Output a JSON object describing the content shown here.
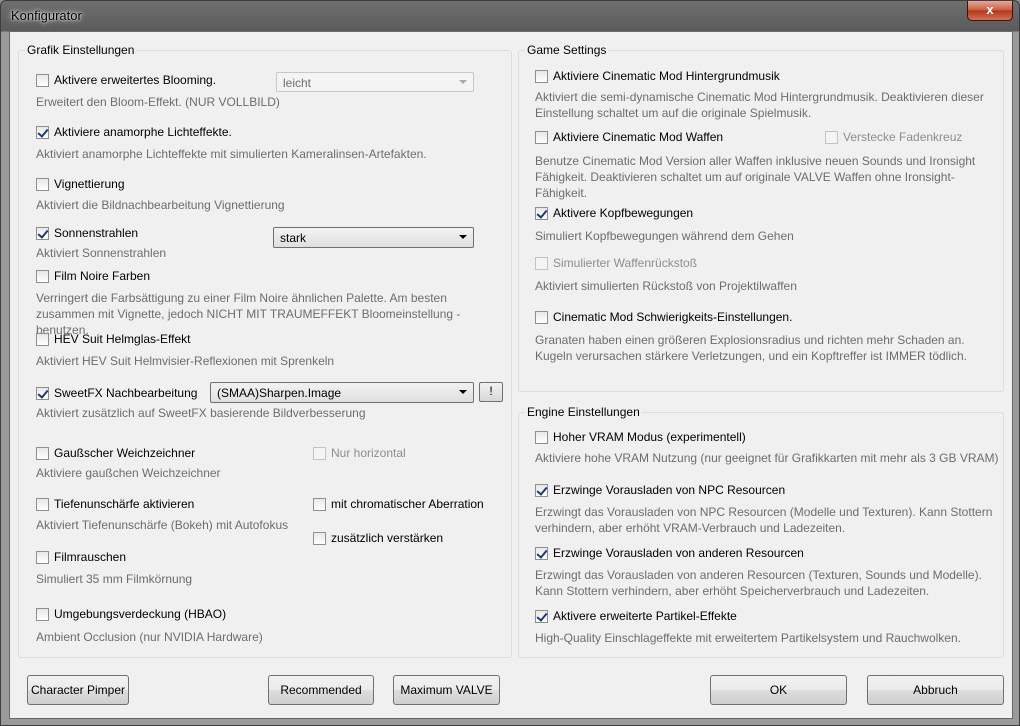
{
  "window": {
    "title": "Konfigurator",
    "close_glyph": "x"
  },
  "grafik": {
    "title": "Grafik Einstellungen",
    "blooming": {
      "label": "Aktivere erweitertes Blooming.",
      "checked": false,
      "desc": "Erweitert den Bloom-Effekt. (NUR VOLLBILD)",
      "select_value": "leicht"
    },
    "anamorph": {
      "label": "Aktiviere anamorphe Lichteffekte.",
      "checked": true,
      "desc": "Aktiviert anamorphe Lichteffekte mit simulierten Kameralinsen-Artefakten."
    },
    "vignette": {
      "label": "Vignettierung",
      "checked": false,
      "desc": "Aktiviert die Bildnachbearbeitung Vignettierung"
    },
    "sonnen": {
      "label": "Sonnenstrahlen",
      "checked": true,
      "desc": "Aktiviert Sonnenstrahlen",
      "select_value": "stark"
    },
    "filmnoire": {
      "label": "Film Noire Farben",
      "checked": false,
      "desc": "Verringert die Farbsättigung zu einer Film Noire ähnlichen Palette. Am besten zusammen mit Vignette, jedoch NICHT MIT TRAUMEFFEKT Bloomeinstellung - benutzen."
    },
    "hev": {
      "label": "HEV Suit Helmglas-Effekt",
      "checked": false,
      "desc": "Aktiviert HEV Suit Helmvisier-Reflexionen mit Sprenkeln"
    },
    "sweetfx": {
      "label": "SweetFX Nachbearbeitung",
      "checked": true,
      "desc": "Aktiviert zusätzlich auf SweetFX basierende Bildverbesserung",
      "select_value": "(SMAA)Sharpen.Image",
      "info_button": "!"
    },
    "gauss": {
      "label": "Gaußscher Weichzeichner",
      "checked": false,
      "desc": "Aktiviere gaußchen Weichzeichner",
      "extra_label": "Nur horizontal"
    },
    "tiefen": {
      "label": "Tiefenunschärfe aktivieren",
      "checked": false,
      "desc": "Aktiviert Tiefenunschärfe (Bokeh) mit Autofokus",
      "extra1_label": "mit chromatischer Aberration",
      "extra2_label": "zusätzlich verstärken"
    },
    "film": {
      "label": "Filmrauschen",
      "checked": false,
      "desc": "Simuliert 35 mm Filmkörnung"
    },
    "hbao": {
      "label": "Umgebungsverdeckung (HBAO)",
      "checked": false,
      "desc": "Ambient Occlusion (nur NVIDIA Hardware)"
    }
  },
  "game": {
    "title": "Game Settings",
    "musik": {
      "label": "Aktiviere Cinematic Mod Hintergrundmusik",
      "checked": false,
      "desc": "Aktiviert die semi-dynamische Cinematic Mod Hintergrundmusik. Deaktivieren dieser Einstellung schaltet um auf die originale Spielmusik."
    },
    "waffen": {
      "label": "Aktiviere Cinematic Mod Waffen",
      "checked": false,
      "desc": "Benutze Cinematic Mod Version aller Waffen inklusive neuen Sounds und Ironsight Fähigkeit. Deaktivieren schaltet um auf originale VALVE Waffen ohne Ironsight-Fähigkeit.",
      "extra_label": "Verstecke Fadenkreuz"
    },
    "kopf": {
      "label": "Aktivere Kopfbewegungen",
      "checked": true,
      "desc": "Simuliert Kopfbewegungen während dem Gehen"
    },
    "rueck": {
      "label": "Simulierter Waffenrückstoß",
      "checked": false,
      "desc": "Aktiviert simulierten Rückstoß von Projektilwaffen"
    },
    "schwierig": {
      "label": "Cinematic Mod Schwierigkeits-Einstellungen.",
      "checked": false,
      "desc": "Granaten haben einen größeren Explosionsradius und richten mehr Schaden an. Kugeln verursachen stärkere Verletzungen, und ein Kopftreffer ist IMMER tödlich."
    }
  },
  "engine": {
    "title": "Engine Einstellungen",
    "vram": {
      "label": "Hoher VRAM Modus (experimentell)",
      "checked": false,
      "desc": "Aktiviere hohe VRAM Nutzung (nur geeignet für Grafikkarten mit mehr als 3 GB VRAM)"
    },
    "npc": {
      "label": "Erzwinge Vorausladen von NPC Resourcen",
      "checked": true,
      "desc": "Erzwingt das Vorausladen von NPC Resourcen (Modelle und Texturen). Kann Stottern verhindern, aber erhöht VRAM-Verbrauch und Ladezeiten."
    },
    "andere": {
      "label": "Erzwinge Vorausladen von anderen Resourcen",
      "checked": true,
      "desc": "Erzwingt das Vorausladen von anderen Resourcen (Texturen, Sounds und Modelle). Kann Stottern verhindern, aber erhöht Speicherverbrauch und Ladezeiten."
    },
    "partikel": {
      "label": "Aktivere erweiterte Partikel-Effekte",
      "checked": true,
      "desc": "High-Quality Einschlageffekte mit erweitertem Partikelsystem und Rauchwolken."
    }
  },
  "buttons": {
    "character": "Character Pimper",
    "recommended": "Recommended",
    "maximum": "Maximum VALVE",
    "ok": "OK",
    "abbruch": "Abbruch"
  }
}
